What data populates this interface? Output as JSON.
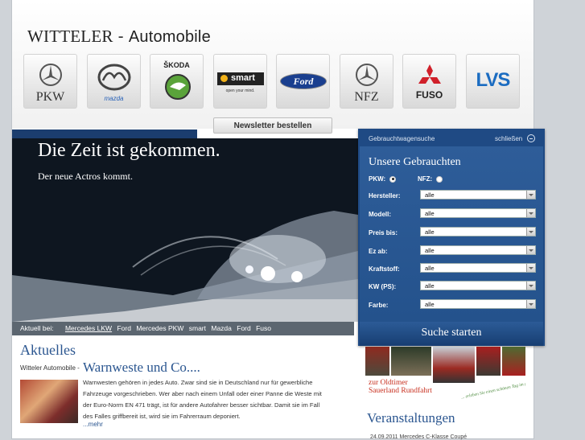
{
  "logo": {
    "part1": "WITTELER",
    "dash": " - ",
    "part2": "Automobile"
  },
  "brands": [
    {
      "name": "mercedes-pkw",
      "label": "PKW"
    },
    {
      "name": "mazda",
      "label": "mazda"
    },
    {
      "name": "skoda",
      "label": "ŠKODA"
    },
    {
      "name": "smart",
      "label": "smart",
      "sub": "open your mind."
    },
    {
      "name": "ford",
      "label": "Ford"
    },
    {
      "name": "mercedes-nfz",
      "label": "NFZ"
    },
    {
      "name": "fuso",
      "label": "FUSO"
    },
    {
      "name": "lvs",
      "label": "LVS"
    }
  ],
  "newsletter": {
    "label": "Newsletter bestellen"
  },
  "hero": {
    "headline": "Die Zeit ist gekommen.",
    "subline": "Der neue Actros kommt."
  },
  "crumbs": {
    "label": "Aktuell bei:",
    "items": [
      "Mercedes LKW",
      "Ford",
      "Mercedes PKW",
      "smart",
      "Mazda",
      "Ford",
      "Fuso"
    ]
  },
  "news": {
    "section": "Aktuelles",
    "source": "Witteler Automobile -",
    "title": "Warnweste und Co....",
    "text": "Warnwesten gehören in jedes Auto. Zwar sind sie in Deutschland nur für gewerbliche Fahrzeuge vorgeschrieben. Wer aber nach einem Unfall oder einer Panne die Weste mit der Euro-Norm EN 471 trägt, ist für andere Autofahrer besser sichtbar. Damit sie im Fall des Falles griffbereit ist, wird sie im Fahrerraum deponiert.",
    "more": "...mehr"
  },
  "search": {
    "header": "Gebrauchtwagensuche",
    "close": "schließen",
    "title": "Unsere Gebrauchten",
    "pkw": "PKW:",
    "nfz": "NFZ:",
    "fields": [
      {
        "label": "Hersteller:",
        "value": "alle"
      },
      {
        "label": "Modell:",
        "value": "alle"
      },
      {
        "label": "Preis bis:",
        "value": "alle"
      },
      {
        "label": "Ez ab:",
        "value": "alle"
      },
      {
        "label": "Kraftstoff:",
        "value": "alle"
      },
      {
        "label": "KW (PS):",
        "value": "alle"
      },
      {
        "label": "Farbe:",
        "value": "alle"
      }
    ],
    "button": "Suche starten"
  },
  "oldtimer": {
    "line1": "zur Oldtimer",
    "line2": "Sauerland Rundfahrt",
    "tagline": "... erleben Sie einen schönen Tag im grünen Sauerland."
  },
  "events": {
    "title": "Veranstaltungen",
    "row": "24.09.2011     Mercedes C-Klasse Coupé"
  },
  "colors": {
    "accent": "#2b5690",
    "panel": "#1f4a84"
  }
}
